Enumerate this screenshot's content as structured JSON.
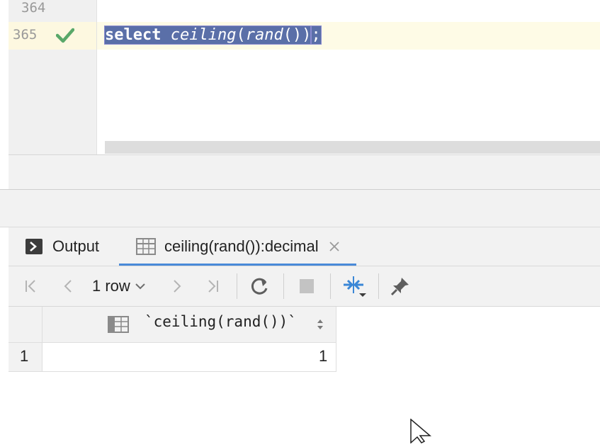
{
  "editor": {
    "lines": [
      {
        "number": "364",
        "code": ""
      },
      {
        "number": "365",
        "status": "check-icon",
        "keyword": "select",
        "func": "ceiling",
        "paren_open": "(",
        "inner_func": "rand",
        "paren_close": "())",
        "terminator": ";"
      }
    ]
  },
  "tabs": [
    {
      "label": "Output",
      "icon": "console-icon"
    },
    {
      "label": "ceiling(rand()):decimal",
      "icon": "table-icon",
      "closable": true
    }
  ],
  "toolbar": {
    "row_count": "1 row"
  },
  "grid": {
    "columns": [
      "`ceiling(rand())`"
    ],
    "rows": [
      {
        "row_number": "1",
        "values": [
          "1"
        ]
      }
    ]
  },
  "colors": {
    "selection": "#5a6fa8",
    "check": "#59a869",
    "accent": "#4a8ad8",
    "current_line": "#fefbe6"
  }
}
